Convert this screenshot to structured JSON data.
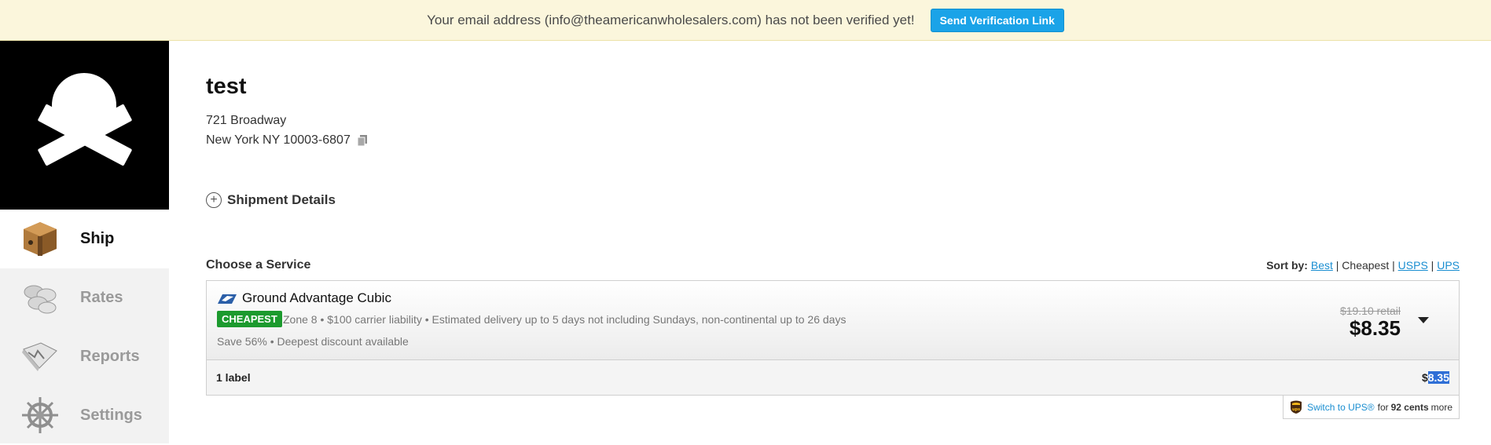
{
  "banner": {
    "message": "Your email address (info@theamericanwholesalers.com) has not been verified yet!",
    "button_label": "Send Verification Link"
  },
  "sidebar": {
    "items": [
      {
        "label": "Ship",
        "icon": "box-icon",
        "active": true
      },
      {
        "label": "Rates",
        "icon": "coins-icon",
        "active": false
      },
      {
        "label": "Reports",
        "icon": "map-icon",
        "active": false
      },
      {
        "label": "Settings",
        "icon": "ship-wheel-icon",
        "active": false
      }
    ]
  },
  "recipient": {
    "name": "test",
    "address_line1": "721 Broadway",
    "address_line2": "New York NY 10003-6807"
  },
  "shipment_details_label": "Shipment Details",
  "choose_service": {
    "title": "Choose a Service",
    "sort_label": "Sort by:",
    "sort_options": [
      "Best",
      "Cheapest",
      "USPS",
      "UPS"
    ],
    "sort_active": "Cheapest"
  },
  "service": {
    "name": "Ground Advantage Cubic",
    "badge": "CHEAPEST",
    "description": "Zone 8 • $100 carrier liability • Estimated delivery up to 5 days not including Sundays, non-continental up to 26 days",
    "savings": "Save 56% • Deepest discount available",
    "retail_price": "$19.10 retail",
    "price": "$8.35"
  },
  "labels": {
    "count": "1 label",
    "total_prefix": "$",
    "total_value": "8.35"
  },
  "ups_switch": {
    "link": "Switch to UPS®",
    "text_for": "for",
    "amount": "92 cents",
    "text_more": "more"
  },
  "colors": {
    "banner_bg": "#fbf6dc",
    "accent_blue": "#1aa3e8",
    "badge_green": "#1c9a2e",
    "link_blue": "#1a8ed1"
  }
}
